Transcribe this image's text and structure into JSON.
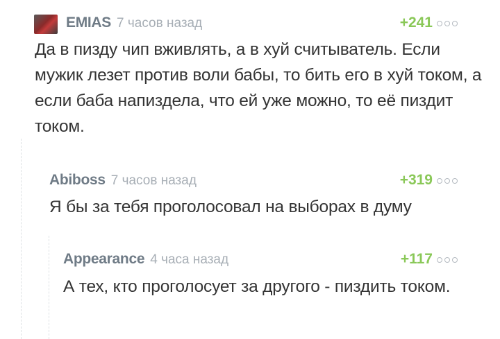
{
  "comments": [
    {
      "author": "EMIAS",
      "time": "7 часов назад",
      "rating": "+241",
      "text": "Да в пизду чип вживлять, а в хуй считыватель. Если мужик лезет против воли бабы, то бить его в хуй током, а если баба напиздела, что ей уже можно, то её пиздит током."
    },
    {
      "author": "Abiboss",
      "time": "7 часов назад",
      "rating": "+319",
      "text": "Я бы за тебя проголосовал на выборах в думу"
    },
    {
      "author": "Appearance",
      "time": "4 часа назад",
      "rating": "+117",
      "text": "А тех, кто проголосует за другого - пиздить током."
    }
  ],
  "colors": {
    "author": "#6f7b86",
    "time": "#a7aeb5",
    "rating": "#8ac858",
    "text": "#343434",
    "thread_line": "#dde1e4"
  },
  "icons": {
    "more": "more-dots-icon",
    "avatar": "avatar"
  }
}
